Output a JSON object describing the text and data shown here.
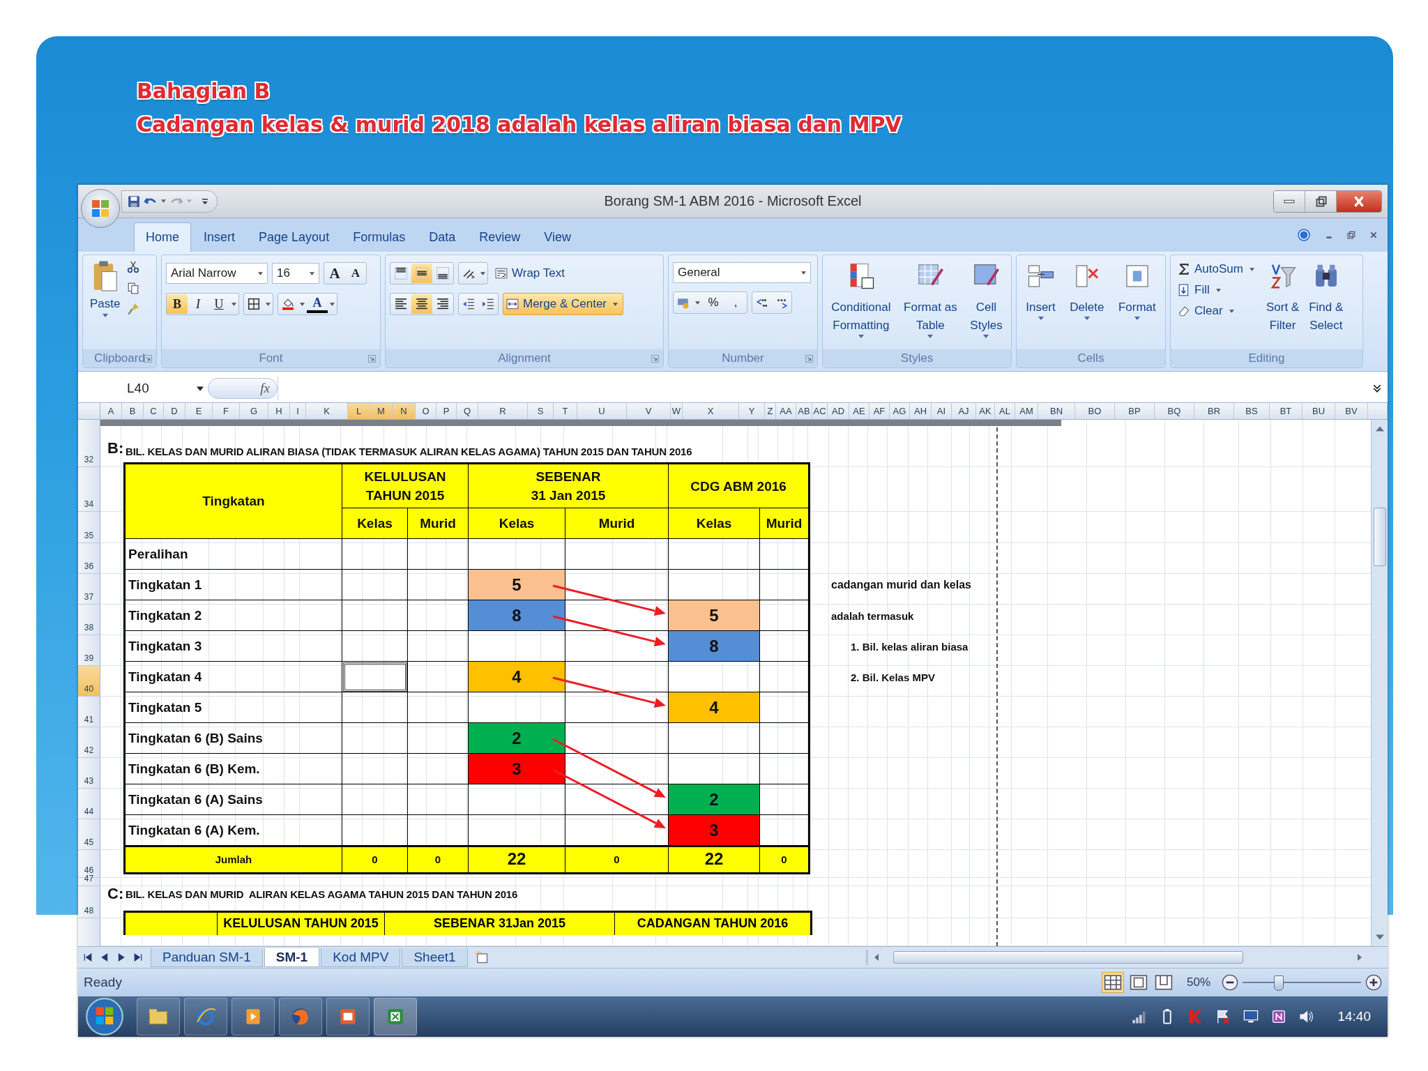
{
  "slide": {
    "title_lines": [
      "Bahagian B",
      "Cadangan kelas & murid 2018 adalah kelas aliran biasa dan MPV"
    ]
  },
  "window": {
    "title": "Borang SM-1 ABM 2016 - Microsoft Excel"
  },
  "ribbon_tabs": [
    {
      "label": "Home",
      "selected": true
    },
    {
      "label": "Insert",
      "selected": false
    },
    {
      "label": "Page Layout",
      "selected": false
    },
    {
      "label": "Formulas",
      "selected": false
    },
    {
      "label": "Data",
      "selected": false
    },
    {
      "label": "Review",
      "selected": false
    },
    {
      "label": "View",
      "selected": false
    }
  ],
  "ribbon": {
    "clipboard": {
      "label": "Clipboard",
      "paste": "Paste"
    },
    "font": {
      "label": "Font",
      "name": "Arial Narrow",
      "size": "16",
      "size_buttons": [
        "A",
        "A"
      ],
      "font_color_label": "A",
      "format_buttons": [
        {
          "label": "B",
          "kind": "bold",
          "on": true
        },
        {
          "label": "I",
          "kind": "italic",
          "on": false
        },
        {
          "label": "U",
          "kind": "underline",
          "on": false
        }
      ]
    },
    "alignment": {
      "label": "Alignment",
      "wrap_text": "Wrap Text",
      "merge": {
        "label": "Merge & Center",
        "on": true
      },
      "top_buttons": [
        {
          "kind": "top",
          "on": false
        },
        {
          "kind": "middle",
          "on": true
        },
        {
          "kind": "bottom",
          "on": false
        }
      ],
      "side_buttons": [
        {
          "kind": "left",
          "on": false
        },
        {
          "kind": "center",
          "on": true
        },
        {
          "kind": "right",
          "on": false
        }
      ]
    },
    "number": {
      "label": "Number",
      "format": "General",
      "symbols": [
        "%",
        ","
      ]
    },
    "styles": {
      "label": "Styles",
      "items": [
        {
          "kind": "conditional",
          "lines": [
            "Conditional",
            "Formatting"
          ]
        },
        {
          "kind": "table",
          "lines": [
            "Format as",
            "Table"
          ]
        },
        {
          "kind": "cell",
          "lines": [
            "Cell",
            "Styles"
          ]
        }
      ]
    },
    "cells": {
      "label": "Cells",
      "items": [
        {
          "kind": "insert",
          "lines": [
            "Insert"
          ]
        },
        {
          "kind": "delete",
          "lines": [
            "Delete"
          ]
        },
        {
          "kind": "format",
          "lines": [
            "Format"
          ]
        }
      ]
    },
    "editing": {
      "label": "Editing",
      "small": [
        {
          "kind": "sum",
          "label": "AutoSum"
        },
        {
          "kind": "fill",
          "label": "Fill"
        },
        {
          "kind": "clear",
          "label": "Clear"
        }
      ],
      "items": [
        {
          "kind": "sort",
          "lines": [
            "Sort &",
            "Filter"
          ]
        },
        {
          "kind": "find",
          "lines": [
            "Find &",
            "Select"
          ]
        }
      ]
    }
  },
  "formula_bar": {
    "name_box": "L40",
    "function_label": "fx"
  },
  "columns": [
    {
      "label": "A",
      "selected": false
    },
    {
      "label": "B",
      "selected": false
    },
    {
      "label": "C",
      "selected": false
    },
    {
      "label": "D",
      "selected": false
    },
    {
      "label": "E",
      "selected": false
    },
    {
      "label": "F",
      "selected": false
    },
    {
      "label": "G",
      "selected": false
    },
    {
      "label": "H",
      "selected": false
    },
    {
      "label": "I",
      "selected": false
    },
    {
      "label": "K",
      "selected": false
    },
    {
      "label": "L",
      "selected": true
    },
    {
      "label": "M",
      "selected": true
    },
    {
      "label": "N",
      "selected": true
    },
    {
      "label": "O",
      "selected": false
    },
    {
      "label": "P",
      "selected": false
    },
    {
      "label": "Q",
      "selected": false
    },
    {
      "label": "R",
      "selected": false
    },
    {
      "label": "S",
      "selected": false
    },
    {
      "label": "T",
      "selected": false
    },
    {
      "label": "U",
      "selected": false
    },
    {
      "label": "V",
      "selected": false
    },
    {
      "label": "W",
      "selected": false
    },
    {
      "label": "X",
      "selected": false
    },
    {
      "label": "Y",
      "selected": false
    },
    {
      "label": "Z",
      "selected": false
    },
    {
      "label": "AA",
      "selected": false
    },
    {
      "label": "AB",
      "selected": false
    },
    {
      "label": "AC",
      "selected": false
    },
    {
      "label": "AD",
      "selected": false
    },
    {
      "label": "AE",
      "selected": false
    },
    {
      "label": "AF",
      "selected": false
    },
    {
      "label": "AG",
      "selected": false
    },
    {
      "label": "AH",
      "selected": false
    },
    {
      "label": "AI",
      "selected": false
    },
    {
      "label": "AJ",
      "selected": false
    },
    {
      "label": "AK",
      "selected": false
    },
    {
      "label": "AL",
      "selected": false
    },
    {
      "label": "AM",
      "selected": false
    },
    {
      "label": "BN",
      "selected": false
    },
    {
      "label": "BO",
      "selected": false
    },
    {
      "label": "BP",
      "selected": false
    },
    {
      "label": "BQ",
      "selected": false
    },
    {
      "label": "BR",
      "selected": false
    },
    {
      "label": "BS",
      "selected": false
    },
    {
      "label": "BT",
      "selected": false
    },
    {
      "label": "BU",
      "selected": false
    },
    {
      "label": "BV",
      "selected": false
    }
  ],
  "row_numbers": [
    {
      "label": "32",
      "selected": false
    },
    {
      "label": "34",
      "selected": false
    },
    {
      "label": "35",
      "selected": false
    },
    {
      "label": "36",
      "selected": false
    },
    {
      "label": "37",
      "selected": false
    },
    {
      "label": "38",
      "selected": false
    },
    {
      "label": "39",
      "selected": false
    },
    {
      "label": "40",
      "selected": true
    },
    {
      "label": "41",
      "selected": false
    },
    {
      "label": "42",
      "selected": false
    },
    {
      "label": "43",
      "selected": false
    },
    {
      "label": "44",
      "selected": false
    },
    {
      "label": "45",
      "selected": false
    },
    {
      "label": "46",
      "selected": false
    },
    {
      "label": "47",
      "selected": false
    },
    {
      "label": "48",
      "selected": false
    }
  ],
  "section_b": {
    "marker": "B:",
    "heading": "BIL. KELAS DAN MURID ALIRAN BIASA (TIDAK TERMASUK ALIRAN KELAS AGAMA) TAHUN 2015 DAN TAHUN 2016",
    "table": {
      "row_header": "Tingkatan",
      "groups": [
        {
          "lines": [
            "KELULUSAN",
            "TAHUN 2015"
          ]
        },
        {
          "lines": [
            "SEBENAR",
            "31 Jan 2015"
          ]
        },
        {
          "lines": [
            "CDG ABM 2016"
          ]
        }
      ],
      "subheaders": [
        "Kelas",
        "Murid",
        "Kelas",
        "Murid",
        "Kelas",
        "Murid"
      ],
      "rows": [
        {
          "label": "Peralihan",
          "cursor": false
        },
        {
          "label": "Tingkatan 1",
          "cursor": false,
          "sebenar_kelas": {
            "text": "5",
            "color": "#fac090",
            "arrow": true
          }
        },
        {
          "label": "Tingkatan 2",
          "cursor": false,
          "sebenar_kelas": {
            "text": "8",
            "color": "#558ed5",
            "arrow": true
          },
          "cdg_kelas": {
            "text": "5",
            "color": "#fac090"
          }
        },
        {
          "label": "Tingkatan 3",
          "cursor": false,
          "cdg_kelas": {
            "text": "8",
            "color": "#558ed5"
          }
        },
        {
          "label": "Tingkatan 4",
          "cursor": true,
          "sebenar_kelas": {
            "text": "4",
            "color": "#ffc000",
            "arrow": true
          }
        },
        {
          "label": "Tingkatan 5",
          "cursor": false,
          "cdg_kelas": {
            "text": "4",
            "color": "#ffc000"
          }
        },
        {
          "label": "Tingkatan 6 (B) Sains",
          "cursor": false,
          "sebenar_kelas": {
            "text": "2",
            "color": "#00b050",
            "arrow": true
          }
        },
        {
          "label": "Tingkatan 6 (B) Kem.",
          "cursor": false,
          "sebenar_kelas": {
            "text": "3",
            "color": "#ff0000",
            "arrow": true
          }
        },
        {
          "label": "Tingkatan 6 (A) Sains",
          "cursor": false,
          "cdg_kelas": {
            "text": "2",
            "color": "#00b050"
          }
        },
        {
          "label": "Tingkatan 6 (A) Kem.",
          "cursor": false,
          "cdg_kelas": {
            "text": "3",
            "color": "#ff0000"
          }
        }
      ],
      "total": {
        "label": "Jumlah",
        "values": [
          "0",
          "0",
          "22",
          "0",
          "22",
          "0"
        ]
      }
    },
    "notes": [
      {
        "kind": "lead",
        "text": "cadangan murid dan kelas"
      },
      {
        "kind": "plain",
        "text": "adalah termasuk"
      },
      {
        "kind": "item",
        "text": "1. Bil. kelas aliran biasa"
      },
      {
        "kind": "item",
        "text": "2. Bil. Kelas MPV"
      }
    ]
  },
  "section_c": {
    "marker": "C:",
    "heading": "BIL. KELAS DAN MURID  ALIRAN KELAS AGAMA TAHUN 2015 DAN TAHUN 2016",
    "table_headers": [
      "KELULUSAN TAHUN 2015",
      "SEBENAR 31Jan 2015",
      "CADANGAN TAHUN 2016"
    ]
  },
  "sheet_tabs": [
    {
      "label": "Panduan SM-1",
      "selected": false
    },
    {
      "label": "SM-1",
      "selected": true
    },
    {
      "label": "Kod MPV",
      "selected": false
    },
    {
      "label": "Sheet1",
      "selected": false
    }
  ],
  "status_bar": {
    "text": "Ready",
    "zoom": "50%",
    "zoom_slider": {
      "level": 0.3
    }
  },
  "taskbar": {
    "clock": "14:40"
  }
}
